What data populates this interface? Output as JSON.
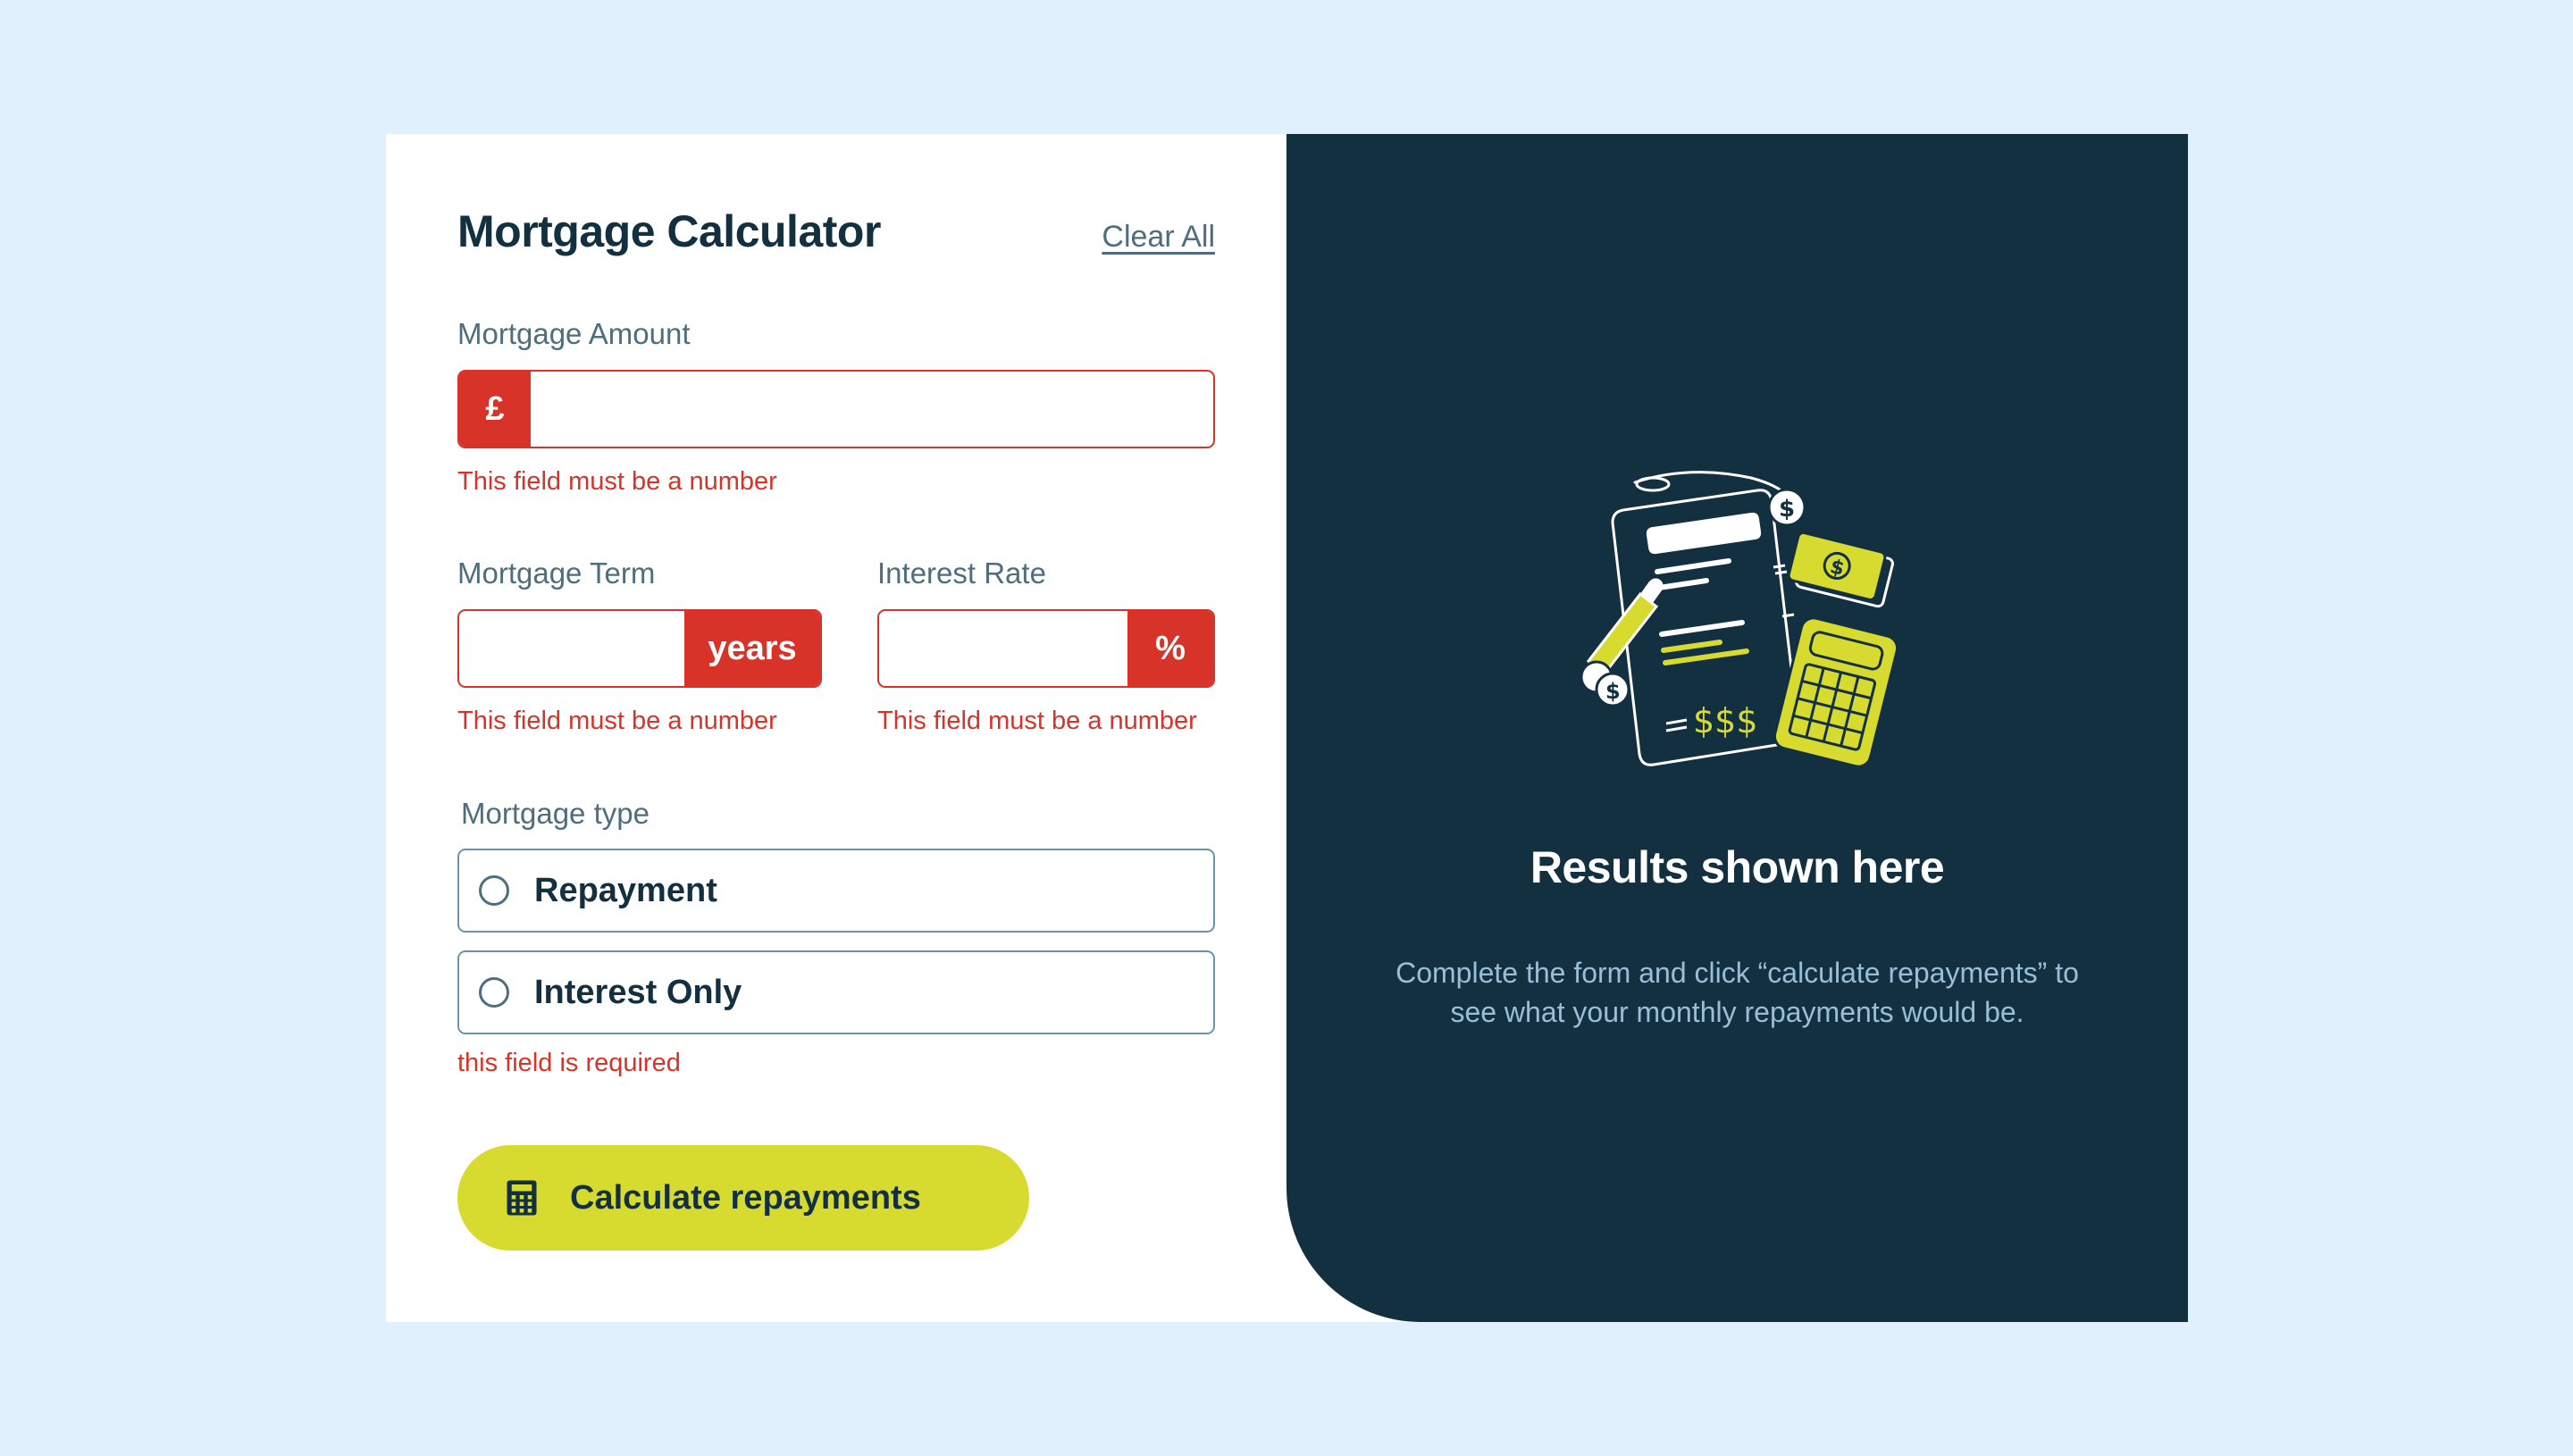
{
  "form": {
    "title": "Mortgage Calculator",
    "clear_all": "Clear All",
    "amount": {
      "label": "Mortgage Amount",
      "prefix": "£",
      "value": "",
      "error": "This field must be a number"
    },
    "term": {
      "label": "Mortgage Term",
      "suffix": "years",
      "value": "",
      "error": "This field must be a number"
    },
    "rate": {
      "label": "Interest Rate",
      "suffix": "%",
      "value": "",
      "error": "This field must be a number"
    },
    "type": {
      "label": "Mortgage type",
      "options": [
        "Repayment",
        "Interest Only"
      ],
      "selected": null,
      "error": "this field is required"
    },
    "submit_label": "Calculate repayments"
  },
  "results": {
    "title": "Results shown here",
    "description_line1": "Complete the form and click “calculate repayments” to",
    "description_line2": "see what your monthly repayments would be."
  },
  "colors": {
    "navy": "#133041",
    "lime": "#d8db2f",
    "error_red": "#d73328",
    "slate": "#4e6e7e",
    "background": "#e0f0fc"
  },
  "icons": {
    "submit": "calculator-icon",
    "empty_state": "mortgage-documents-illustration"
  }
}
